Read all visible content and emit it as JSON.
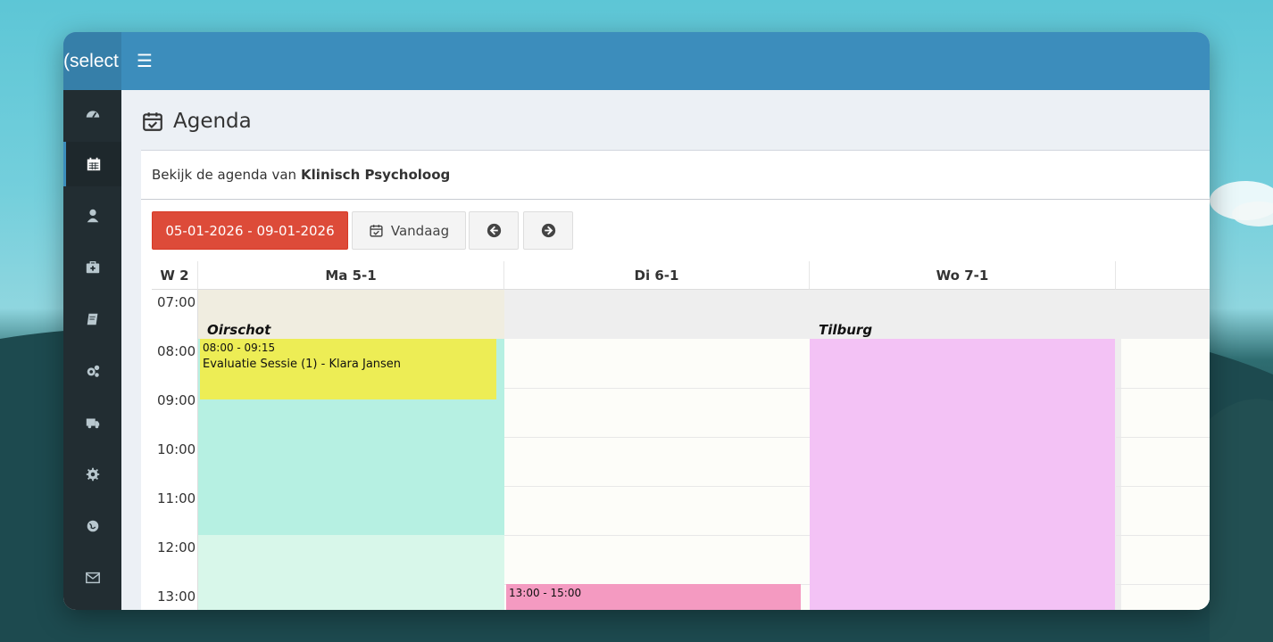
{
  "header": {
    "logo_text": "(select",
    "menu_icon": "hamburger-icon"
  },
  "sidebar": {
    "items": [
      {
        "name": "dashboard",
        "icon": "dashboard-icon"
      },
      {
        "name": "calendar",
        "icon": "calendar-icon",
        "active": true
      },
      {
        "name": "user",
        "icon": "user-icon"
      },
      {
        "name": "medical",
        "icon": "medkit-icon"
      },
      {
        "name": "book",
        "icon": "book-icon"
      },
      {
        "name": "cogs",
        "icon": "cogs-icon"
      },
      {
        "name": "truck",
        "icon": "truck-icon"
      },
      {
        "name": "settings",
        "icon": "gear-icon"
      },
      {
        "name": "globe",
        "icon": "globe-icon"
      },
      {
        "name": "mail",
        "icon": "envelope-icon"
      }
    ]
  },
  "page": {
    "title": "Agenda",
    "subtitle_prefix": "Bekijk de agenda van",
    "subtitle_name": "Klinisch Psycholoog"
  },
  "toolbar": {
    "date_range": "05-01-2026 - 09-01-2026",
    "today_label": "Vandaag",
    "prev_icon": "arrow-left-circle-icon",
    "next_icon": "arrow-right-circle-icon"
  },
  "calendar": {
    "week_label": "W 2",
    "days": [
      "Ma 5-1",
      "Di 6-1",
      "Wo 7-1"
    ],
    "hours": [
      "07:00",
      "08:00",
      "09:00",
      "10:00",
      "11:00",
      "12:00",
      "13:00"
    ],
    "locations": [
      {
        "day": 0,
        "label": "Oirschot"
      },
      {
        "day": 2,
        "label": "Tilburg"
      }
    ],
    "events": [
      {
        "day": 0,
        "time": "08:00 - 09:15",
        "title": "Evaluatie Sessie (1) - Klara Jansen",
        "color": "#eded55"
      },
      {
        "day": 1,
        "time": "13:00 - 15:00",
        "title": "",
        "color": "#f49ac1"
      }
    ],
    "colors": {
      "monday_block": "#b6f0e2",
      "monday_light": "#d8f7ea",
      "wednesday_block": "#f3c2f5",
      "closed": "#eeeeee",
      "open": "#fdfdf9"
    }
  }
}
